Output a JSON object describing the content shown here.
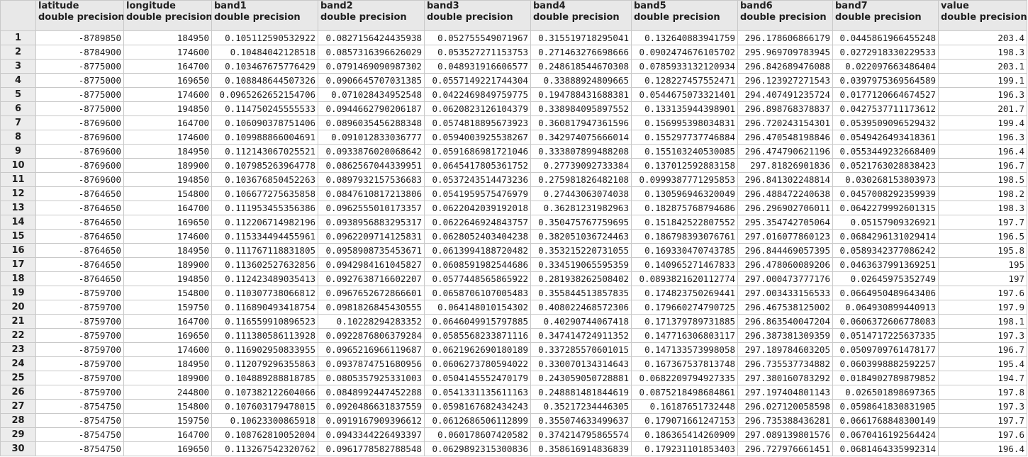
{
  "columns": [
    {
      "name": "latitude",
      "type": "double precision"
    },
    {
      "name": "longitude",
      "type": "double precision"
    },
    {
      "name": "band1",
      "type": "double precision"
    },
    {
      "name": "band2",
      "type": "double precision"
    },
    {
      "name": "band3",
      "type": "double precision"
    },
    {
      "name": "band4",
      "type": "double precision"
    },
    {
      "name": "band5",
      "type": "double precision"
    },
    {
      "name": "band6",
      "type": "double precision"
    },
    {
      "name": "band7",
      "type": "double precision"
    },
    {
      "name": "value",
      "type": "double precision"
    }
  ],
  "rows": [
    [
      "1",
      "-8789850",
      "184950",
      "0.105112590532922",
      "0.0827156424435938",
      "0.052755549071967",
      "0.315519718295041",
      "0.132640883941759",
      "296.178606866179",
      "0.0445861966455248",
      "203.4"
    ],
    [
      "2",
      "-8784900",
      "174600",
      "0.10484042128518",
      "0.0857316396626029",
      "0.053527271153753",
      "0.271463276698666",
      "0.0902474676105702",
      "295.969709783945",
      "0.0272918330229533",
      "198.3"
    ],
    [
      "3",
      "-8775000",
      "164700",
      "0.103467675776429",
      "0.0791469090987302",
      "0.048931916606577",
      "0.248618544670308",
      "0.0785933132120934",
      "296.842689476088",
      "0.022097663486404",
      "203.1"
    ],
    [
      "4",
      "-8775000",
      "169650",
      "0.108848644507326",
      "0.0906645707031385",
      "0.0557149221744304",
      "0.33888924809665",
      "0.12822745755247 1",
      "296.123927271543",
      "0.0397975369564589",
      "199.1"
    ],
    [
      "5",
      "-8775000",
      "174600",
      "0.0965262652154706",
      "0.071028434952548",
      "0.0422469849759775",
      "0.19478843168838 1",
      "0.0544675073321401",
      "294.407491235724",
      "0.0177120664674527",
      "196.3"
    ],
    [
      "6",
      "-8775000",
      "194850",
      "0.114750245555533",
      "0.0944662790206187",
      "0.0620823126104379",
      "0.338984095897552",
      "0.133135944398901",
      "296.898768378837",
      "0.0427537711173612",
      "201.7"
    ],
    [
      "7",
      "-8769600",
      "164700",
      "0.106090378751406",
      "0.0896035456288348",
      "0.0574818895673923",
      "0.360817947361596",
      "0.156995398034831",
      "296.720243154301",
      "0.0539509096529432",
      "199.4"
    ],
    [
      "8",
      "-8769600",
      "174600",
      "0.109988866004691",
      "0.091012833036777",
      "0.0594003925538267",
      "0.342974075666014",
      "0.155297737746884",
      "296.470548198846",
      "0.0549426493418361",
      "196.3"
    ],
    [
      "9",
      "-8769600",
      "184950",
      "0.112143067025521",
      "0.0933876020068642",
      "0.0591686981721046",
      "0.333807899488208",
      "0.155103240530085",
      "296.474790621196",
      "0.0553449232668409",
      "196.4"
    ],
    [
      "10",
      "-8769600",
      "189900",
      "0.107985263964778",
      "0.0862567044339951",
      "0.0645417805361752",
      "0.27739092733384",
      "0.137012592883158",
      "297.81826901836",
      "0.0521763028838423",
      "196.7"
    ],
    [
      "11",
      "-8769600",
      "194850",
      "0.103676850452263",
      "0.0897932157536683",
      "0.0537243514473236",
      "0.275981826482108",
      "0.0999387771295853",
      "296.841302248814",
      "0.030268153803973",
      "198.5"
    ],
    [
      "12",
      "-8764650",
      "154800",
      "0.106677275635858",
      "0.0847610817213806",
      "0.0541959575476979",
      "0.27443063074038",
      "0.130596946320049",
      "296.488472240638",
      "0.0457008292359939",
      "198.2"
    ],
    [
      "13",
      "-8764650",
      "164700",
      "0.111953455356386",
      "0.0962555010173357",
      "0.0622042039192018",
      "0.36281231982963",
      "0.182875768794686",
      "296.296902706011",
      "0.0642279992601315",
      "198.3"
    ],
    [
      "14",
      "-8764650",
      "169650",
      "0.112206714982196",
      "0.0938956883295317",
      "0.0622646924843757",
      "0.350475767759695",
      "0.151842522807552",
      "295.354742705064",
      "0.0515790932692 1",
      "197.7"
    ],
    [
      "15",
      "-8764650",
      "174600",
      "0.115334494455961",
      "0.0962209714125831",
      "0.0628052403404238",
      "0.382051036724463",
      "0.186798393076761",
      "297.016077860123",
      "0.0684296131029414",
      "196.5"
    ],
    [
      "16",
      "-8764650",
      "184950",
      "0.111767118831805",
      "0.0958908735453671",
      "0.0613994188720482",
      "0.353215220731055",
      "0.169330470743785",
      "296.844469057395",
      "0.0589342377086242",
      "195.8"
    ],
    [
      "17",
      "-8764650",
      "189900",
      "0.113602527632856",
      "0.0942984161045827",
      "0.0608591982544686",
      "0.334519065595359",
      "0.140965271467833",
      "296.478060089206",
      "0.0463637991369251",
      "195"
    ],
    [
      "18",
      "-8764650",
      "194850",
      "0.112423489035413",
      "0.0927638716602207",
      "0.0577448565865922",
      "0.281938262508402",
      "0.0893821620112774",
      "297.000473777176",
      "0.02645975352749",
      "197"
    ],
    [
      "19",
      "-8759700",
      "154800",
      "0.110307738066812",
      "0.0967652672866601",
      "0.0658706107005483",
      "0.355844513857835",
      "0.174823750269441",
      "297.003433156533",
      "0.0664950489643406",
      "197.6"
    ],
    [
      "20",
      "-8759700",
      "159750",
      "0.116890493418754",
      "0.0981826845430555",
      "0.064148010154302",
      "0.408022468572306",
      "0.179660274790725",
      "296.467538125002",
      "0.064930899440913",
      "197.9"
    ],
    [
      "21",
      "-8759700",
      "164700",
      "0.116559910896523",
      "0.10228294283352",
      "0.0646049915797885",
      "0.40290744067418",
      "0.171379789731885",
      "296.863540047204",
      "0.0606372606778083",
      "198.1"
    ],
    [
      "22",
      "-8759700",
      "169650",
      "0.111380586113928",
      "0.0922876806379284",
      "0.0585568233871116",
      "0.347414724911352",
      "0.147716306803117",
      "296.387381309359",
      "0.0514717225637335",
      "197.3"
    ],
    [
      "23",
      "-8759700",
      "174600",
      "0.116902950833955",
      "0.0965216966119687",
      "0.0621962690180189",
      "0.337285570601015",
      "0.147133573998058",
      "297.189784603205",
      "0.0509709761478177",
      "196.7"
    ],
    [
      "24",
      "-8759700",
      "184950",
      "0.112079296355863",
      "0.0937874751680956",
      "0.0606273780594022",
      "0.330070134314643",
      "0.167367537813748",
      "296.735537734882",
      "0.0603998882592257",
      "195.4"
    ],
    [
      "25",
      "-8759700",
      "189900",
      "0.104889288818785",
      "0.0805357925331003",
      "0.0504145552470179",
      "0.243059050728881",
      "0.0682209794927335",
      "297.380160783292",
      "0.0184902789879852",
      "194.7"
    ],
    [
      "26",
      "-8759700",
      "244800",
      "0.107382122604066",
      "0.0848992447452288",
      "0.0541331135611163",
      "0.248881481844619",
      "0.0875218498684861",
      "297.197404801143",
      "0.026501898697365",
      "197.8"
    ],
    [
      "27",
      "-8754750",
      "154800",
      "0.107603179478015",
      "0.0920486631837559",
      "0.0598167682434243",
      "0.35217234446305",
      "0.16187651732448",
      "296.027120058598",
      "0.0598641830831905",
      "197.3"
    ],
    [
      "28",
      "-8754750",
      "159750",
      "0.10623300865918",
      "0.0919167909396612",
      "0.0612686506112899",
      "0.355074633499637",
      "0.17907166124715 3",
      "296.735388436281",
      "0.0661768848300149",
      "197.7"
    ],
    [
      "29",
      "-8754750",
      "164700",
      "0.108762810052004",
      "0.0943344226493397",
      "0.060178607420582",
      "0.374214795865574",
      "0.186365414260909",
      "297.089139801576",
      "0.0670416192564424",
      "197.6"
    ],
    [
      "30",
      "-8754750",
      "169650",
      "0.113267542320762",
      "0.0961778582788548",
      "0.0629892315300836",
      "0.358616914836839",
      "0.179231101853403",
      "296.727976661451",
      "0.0681464335992314",
      "196.4"
    ]
  ]
}
